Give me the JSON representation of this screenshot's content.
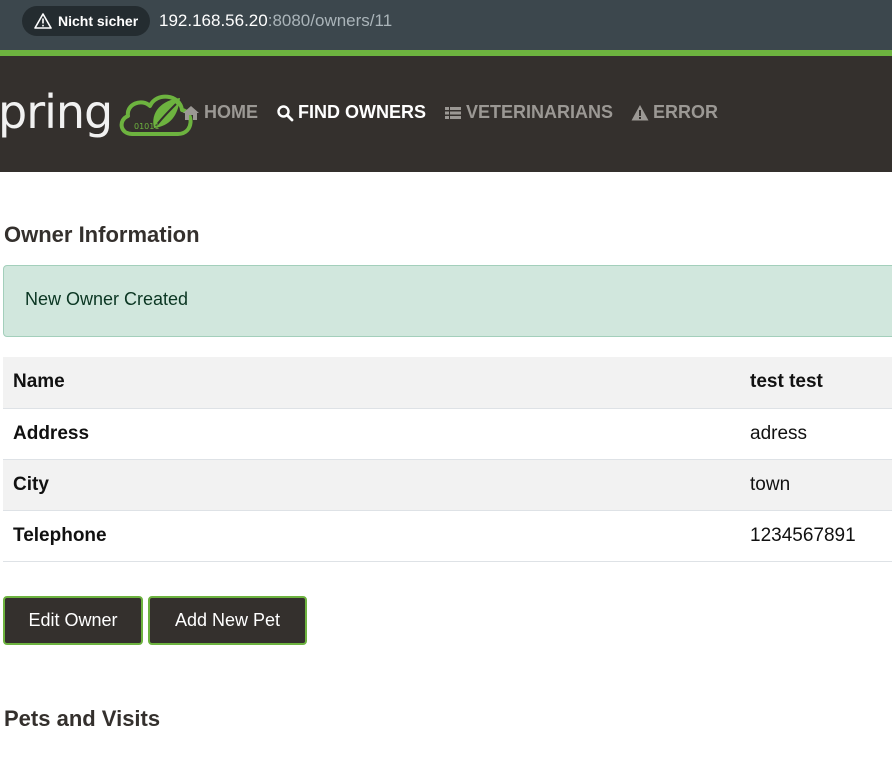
{
  "browser": {
    "security_label": "Nicht sicher",
    "url_host": "192.168.56.20",
    "url_rest": ":8080/owners/11"
  },
  "navbar": {
    "brand_text": "pring",
    "items": [
      {
        "label": "HOME",
        "icon": "home-icon"
      },
      {
        "label": "FIND OWNERS",
        "icon": "search-icon"
      },
      {
        "label": "VETERINARIANS",
        "icon": "th-list-icon"
      },
      {
        "label": "ERROR",
        "icon": "warning-icon"
      }
    ],
    "active": "FIND OWNERS"
  },
  "main": {
    "title": "Owner Information",
    "alert": "New Owner Created",
    "owner": [
      {
        "label": "Name",
        "value": "test test"
      },
      {
        "label": "Address",
        "value": "adress"
      },
      {
        "label": "City",
        "value": "town"
      },
      {
        "label": "Telephone",
        "value": "1234567891"
      }
    ],
    "buttons": {
      "edit": "Edit Owner",
      "add_pet": "Add New Pet"
    },
    "pets_title": "Pets and Visits"
  },
  "colors": {
    "accent": "#6db33f",
    "navbar": "#34302d",
    "alert_bg": "#d1e7dd"
  }
}
